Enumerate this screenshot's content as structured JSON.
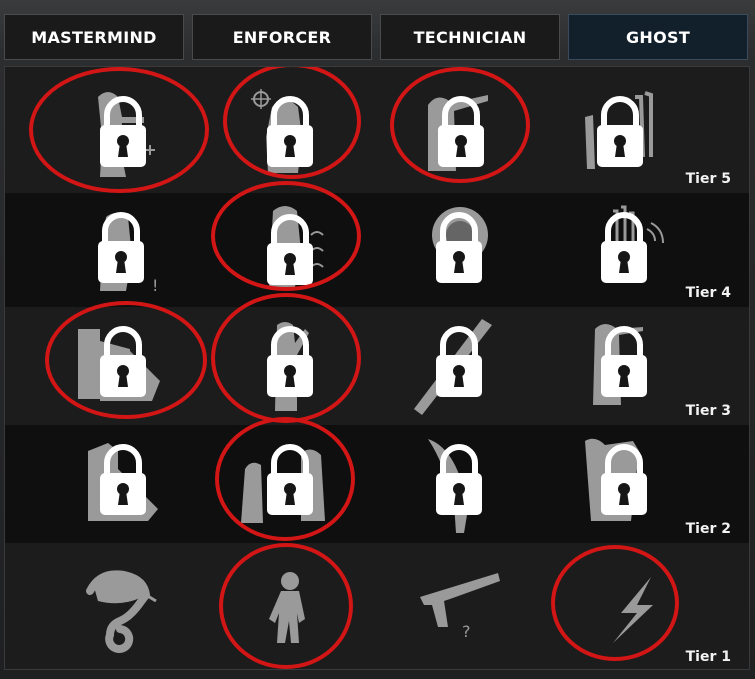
{
  "tabs": [
    {
      "label": "MASTERMIND",
      "active": false
    },
    {
      "label": "ENFORCER",
      "active": false
    },
    {
      "label": "TECHNICIAN",
      "active": false
    },
    {
      "label": "GHOST",
      "active": true
    }
  ],
  "tiers": [
    {
      "label": "Tier 5",
      "skills": [
        {
          "icon": "mastermind-tier5-skill-icon",
          "locked": true,
          "highlighted": true
        },
        {
          "icon": "enforcer-tier5-skill-icon",
          "locked": true,
          "highlighted": true
        },
        {
          "icon": "technician-tier5-skill-icon",
          "locked": true,
          "highlighted": true
        },
        {
          "icon": "ghost-tier5-skill-icon",
          "locked": true,
          "highlighted": false
        }
      ]
    },
    {
      "label": "Tier 4",
      "skills": [
        {
          "icon": "mastermind-tier4-skill-icon",
          "locked": true,
          "highlighted": false
        },
        {
          "icon": "enforcer-tier4-skill-icon",
          "locked": true,
          "highlighted": true
        },
        {
          "icon": "technician-tier4-skill-icon",
          "locked": true,
          "highlighted": false
        },
        {
          "icon": "ghost-tier4-skill-icon",
          "locked": true,
          "highlighted": false
        }
      ]
    },
    {
      "label": "Tier 3",
      "skills": [
        {
          "icon": "mastermind-tier3-skill-icon",
          "locked": true,
          "highlighted": true
        },
        {
          "icon": "enforcer-tier3-skill-icon",
          "locked": true,
          "highlighted": true
        },
        {
          "icon": "technician-tier3-skill-icon",
          "locked": true,
          "highlighted": false
        },
        {
          "icon": "ghost-tier3-skill-icon",
          "locked": true,
          "highlighted": false
        }
      ]
    },
    {
      "label": "Tier 2",
      "skills": [
        {
          "icon": "mastermind-tier2-skill-icon",
          "locked": true,
          "highlighted": false
        },
        {
          "icon": "enforcer-tier2-skill-icon",
          "locked": true,
          "highlighted": true
        },
        {
          "icon": "technician-tier2-skill-icon",
          "locked": true,
          "highlighted": false
        },
        {
          "icon": "ghost-tier2-skill-icon",
          "locked": true,
          "highlighted": false
        }
      ]
    },
    {
      "label": "Tier 1",
      "skills": [
        {
          "icon": "chameleon-icon",
          "locked": false,
          "highlighted": false
        },
        {
          "icon": "running-figure-icon",
          "locked": false,
          "highlighted": true
        },
        {
          "icon": "silenced-pistol-icon",
          "locked": false,
          "highlighted": false
        },
        {
          "icon": "lightning-bolt-icon",
          "locked": false,
          "highlighted": true
        }
      ]
    }
  ],
  "colors": {
    "highlight_ring": "#d21515",
    "lock": "#ffffff",
    "skill_silhouette": "#9a9a9a",
    "active_tab": "#12202c"
  }
}
